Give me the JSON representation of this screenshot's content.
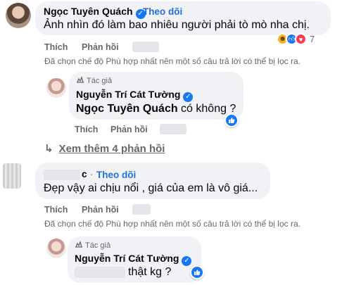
{
  "comment1": {
    "author": "Ngọc Tuyên Quách",
    "follow": "Theo dõi",
    "text": "Ảnh nhìn đó làm bao nhiêu người phải tò mò nha chị.",
    "actions": {
      "like": "Thích",
      "reply": "Phản hồi"
    },
    "reaction_count": "7",
    "filter_note": "Đã chọn chế độ Phù hợp nhất nên một số câu trả lời có thể bị lọc ra."
  },
  "reply1": {
    "tag": "Tác giả",
    "author": "Nguyễn Trí Cát Tường",
    "mention": "Ngọc Tuyên Quách",
    "text": " có không ?",
    "actions": {
      "like": "Thích",
      "reply": "Phản hồi"
    }
  },
  "more_replies": {
    "label": "Xem thêm 4 phản hồi"
  },
  "comment2": {
    "author_suffix": "c",
    "follow": "Theo dõi",
    "text": "Đẹp vậy ai chịu nổi , giá của em là vô giá...",
    "actions": {
      "like": "Thích",
      "reply": "Phản hồi"
    },
    "filter_note": "Đã chọn chế độ Phù hợp nhất nên một số câu trả lời có thể bị lọc ra."
  },
  "reply2": {
    "tag": "Tác giả",
    "author": "Nguyễn Trí Cát Tường",
    "text": "thật kg ?"
  },
  "colors": {
    "link": "#216fdb",
    "bubble": "#f0f2f5",
    "secondary": "#65676b",
    "verified": "#1877f2"
  },
  "icons": [
    "verified-badge-icon",
    "haha-reaction-icon",
    "like-reaction-icon",
    "love-reaction-icon",
    "reply-arrow-icon",
    "author-tag-icon"
  ]
}
